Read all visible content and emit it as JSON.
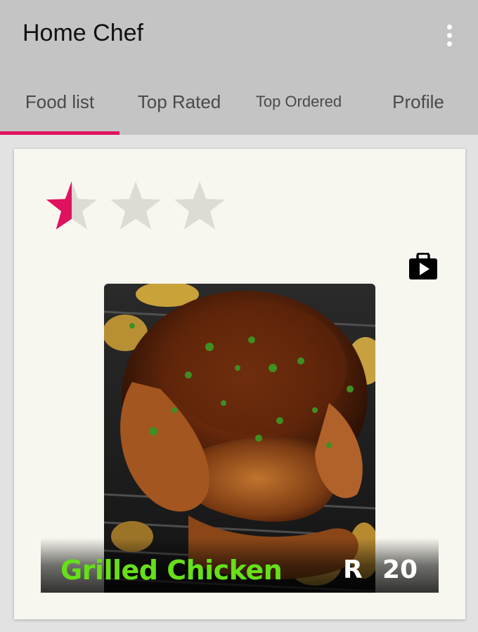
{
  "app": {
    "title": "Home Chef",
    "overflow_icon": "more-vert-icon"
  },
  "tabs": [
    {
      "label": "Food list",
      "selected": true
    },
    {
      "label": "Top Rated",
      "selected": false
    },
    {
      "label": "Top Ordered",
      "selected": false
    },
    {
      "label": "Profile",
      "selected": false
    }
  ],
  "colors": {
    "accent": "#e0115f",
    "app_bar": "#c4c4c4",
    "card_bg": "#f7f6ef",
    "star_empty": "#dcdcd4",
    "food_name": "#66e019"
  },
  "food_card": {
    "rating": 0.5,
    "rating_max": 3,
    "action_icon": "shopping-bag-play-icon",
    "image": "grilled-chicken-photo",
    "name": "Grilled Chicken",
    "currency": "R",
    "price": "20"
  }
}
